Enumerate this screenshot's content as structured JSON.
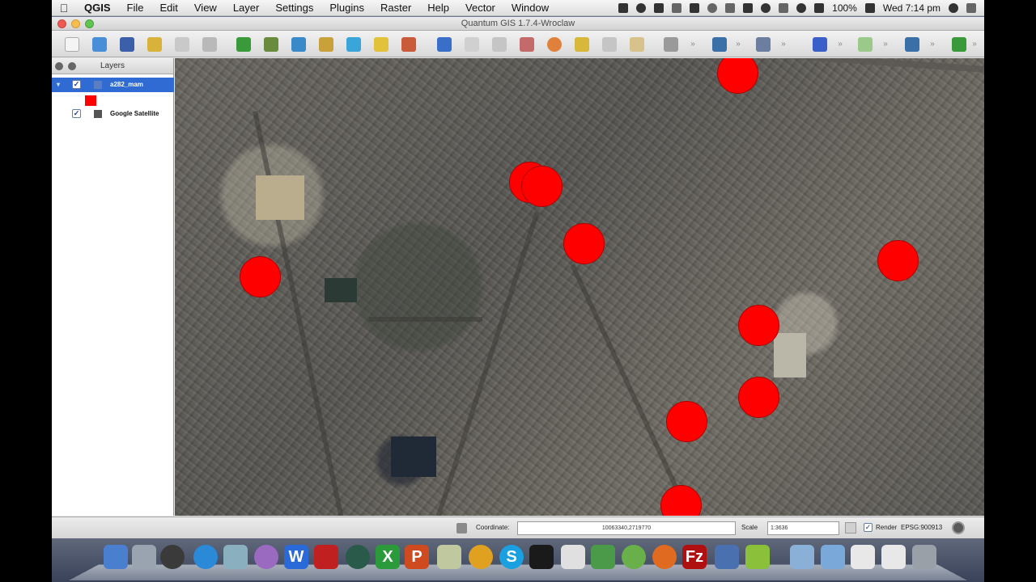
{
  "menubar": {
    "apple_icon": "apple-logo-icon",
    "app_name": "QGIS",
    "items": [
      "File",
      "Edit",
      "View",
      "Layer",
      "Settings",
      "Plugins",
      "Raster",
      "Help",
      "Vector",
      "Window"
    ],
    "battery": "100%",
    "clock": "Wed 7:14 pm"
  },
  "window": {
    "title": "Quantum GIS 1.7.4-Wroclaw"
  },
  "layers": {
    "header": "Layers",
    "items": [
      {
        "label": "a282_mam",
        "checked": true,
        "selected": true,
        "symbol_color": "#ff0000"
      },
      {
        "label": "Google Satellite",
        "checked": true,
        "selected": false
      }
    ]
  },
  "statusbar": {
    "coordinate_label": "Coordinate:",
    "coordinate_value": "10063340,2719770",
    "scale_label": "Scale",
    "scale_value": "1:3636",
    "render_label": "Render",
    "crs": "EPSG:900913"
  },
  "colors": {
    "marker": "#ff0000",
    "selection": "#2f6bd2"
  }
}
